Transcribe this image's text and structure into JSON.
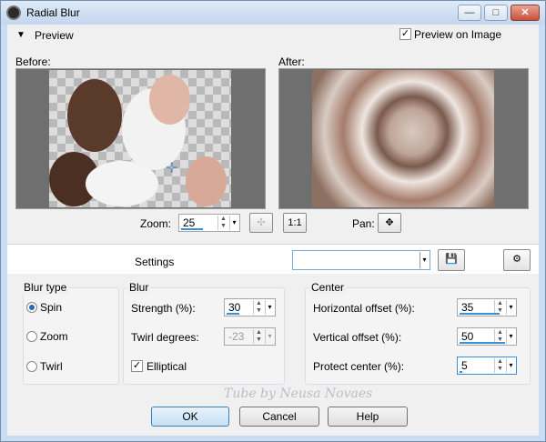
{
  "window": {
    "title": "Radial Blur",
    "minimize": "—",
    "maximize": "□",
    "close": "✕"
  },
  "preview": {
    "toggle_label": "Preview",
    "preview_on_image_label": "Preview on Image",
    "preview_on_image_checked": true,
    "before_label": "Before:",
    "after_label": "After:",
    "zoom_label": "Zoom:",
    "zoom_value": "25",
    "one_to_one": "1:1",
    "pan_label": "Pan:"
  },
  "settings": {
    "label": "Settings",
    "preset_value": ""
  },
  "blur_type": {
    "title": "Blur type",
    "options": [
      "Spin",
      "Zoom",
      "Twirl"
    ],
    "selected": "Spin"
  },
  "blur": {
    "title": "Blur",
    "strength_label": "Strength (%):",
    "strength_value": "30",
    "twirl_label": "Twirl degrees:",
    "twirl_value": "-23",
    "elliptical_label": "Elliptical",
    "elliptical_checked": true
  },
  "center": {
    "title": "Center",
    "h_offset_label": "Horizontal offset (%):",
    "h_offset_value": "35",
    "v_offset_label": "Vertical offset (%):",
    "v_offset_value": "50",
    "protect_label": "Protect center (%):",
    "protect_value": "5"
  },
  "buttons": {
    "ok": "OK",
    "cancel": "Cancel",
    "help": "Help"
  },
  "watermark": "Tube by Neusa Novaes",
  "colors": {
    "accent": "#3a8fd6",
    "title_bar": "#c9dcf0"
  },
  "icons": {
    "app": "app-icon",
    "save": "save-icon",
    "presets": "presets-icon",
    "pan": "pan-cross-icon",
    "fit": "fit-icon"
  }
}
